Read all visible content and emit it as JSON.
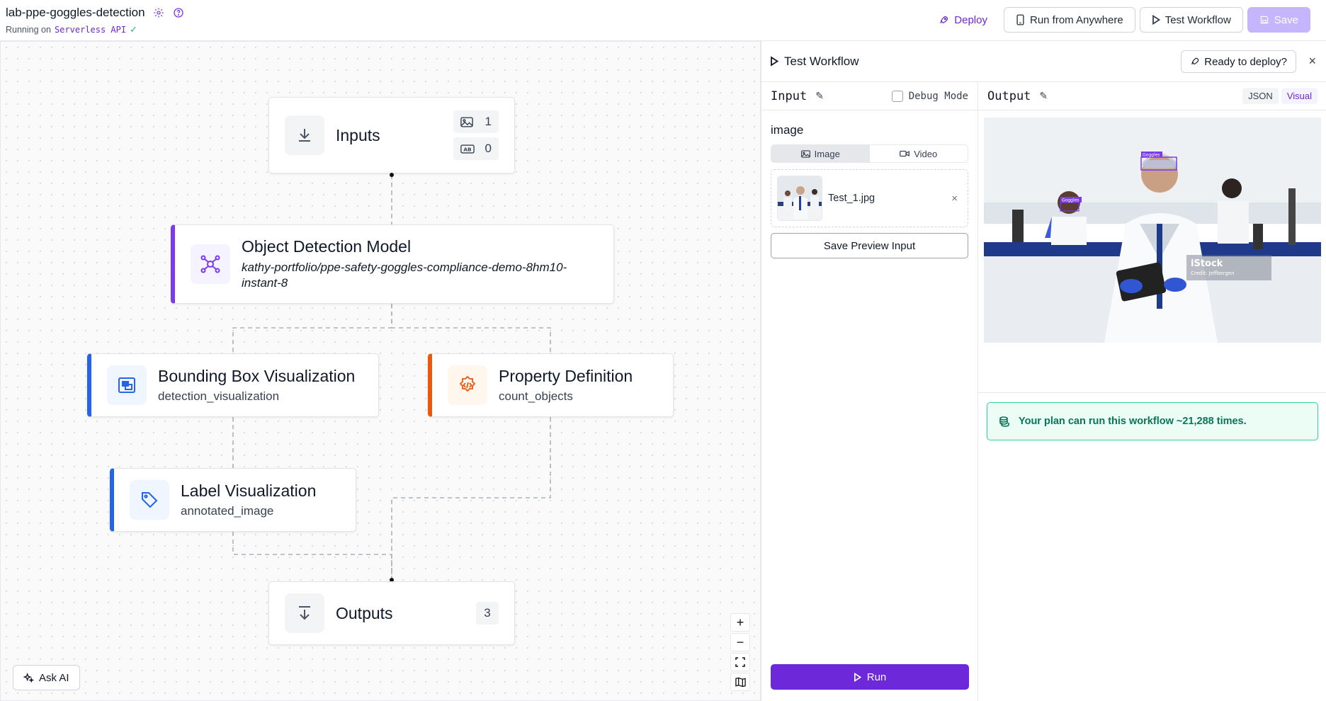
{
  "header": {
    "title": "lab-ppe-goggles-detection",
    "running_prefix": "Running on",
    "running_target": "Serverless API",
    "deploy_label": "Deploy",
    "run_anywhere_label": "Run from Anywhere",
    "test_workflow_label": "Test Workflow",
    "save_label": "Save"
  },
  "nodes": {
    "inputs": {
      "title": "Inputs",
      "image_count": "1",
      "param_count": "0"
    },
    "model": {
      "title": "Object Detection Model",
      "subtitle": "kathy-portfolio/ppe-safety-goggles-compliance-demo-8hm10-instant-8"
    },
    "bbox": {
      "title": "Bounding Box Visualization",
      "subtitle": "detection_visualization"
    },
    "property": {
      "title": "Property Definition",
      "subtitle": "count_objects"
    },
    "label": {
      "title": "Label Visualization",
      "subtitle": "annotated_image"
    },
    "outputs": {
      "title": "Outputs",
      "count": "3"
    }
  },
  "canvas": {
    "zoom_controls": [
      "+",
      "−"
    ],
    "ask_ai_label": "Ask AI"
  },
  "panel": {
    "title": "Test Workflow",
    "ready_label": "Ready to deploy?",
    "input": {
      "title": "Input",
      "debug_label": "Debug Mode",
      "field_label": "image",
      "tab_image": "Image",
      "tab_video": "Video",
      "file_name": "Test_1.jpg",
      "save_preview_label": "Save Preview Input",
      "run_label": "Run"
    },
    "output": {
      "title": "Output",
      "json_label": "JSON",
      "visual_label": "Visual",
      "plan_message": "Your plan can run this workflow ~21,288 times.",
      "watermark": "iStock",
      "watermark_credit": "Credit: Jeffbergen",
      "box_label": "Goggles"
    }
  },
  "colors": {
    "accent": "#6d28d9",
    "model_bar": "#7c3aed",
    "viz_bar": "#2563eb",
    "property_bar": "#ea580c",
    "success": "#047857"
  }
}
